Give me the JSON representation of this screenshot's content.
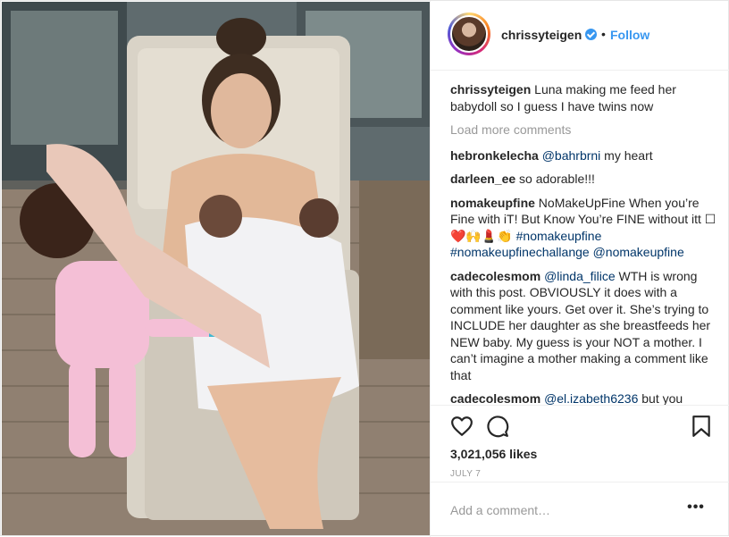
{
  "colors": {
    "link": "#3897f0",
    "hashtag": "#003569",
    "muted": "#999999",
    "text": "#262626",
    "border": "#efefef"
  },
  "photo": {
    "icon": "post-photo"
  },
  "header": {
    "username": "chrissyteigen",
    "verified_icon": "verified-badge-icon",
    "separator": "•",
    "follow_label": "Follow"
  },
  "caption": {
    "username": "chrissyteigen",
    "text": " Luna making me feed her babydoll so I guess I have twins now"
  },
  "load_more_label": "Load more comments",
  "comments": [
    {
      "username": "hebronkelecha",
      "mention": "@bahrbrni",
      "text": " my heart"
    },
    {
      "username": "darleen_ee",
      "text": " so adorable!!!"
    },
    {
      "username": "nomakeupfine",
      "text": " NoMakeUpFine When you’re Fine with iT! But Know You’re FINE without itt ☐❤️🙌💄👏",
      "tags": "#nomakeupfine #nomakeupfinechallange @nomakeupfine"
    },
    {
      "username": "cadecolesmom",
      "mention": "@linda_filice",
      "text": " WTH is wrong with this post. OBVIOUSLY it does with a comment like yours. Get over it. She’s trying to INCLUDE her daughter as she breastfeeds her NEW baby. My guess is your NOT a mother. I can’t imagine a mother making a comment like that"
    },
    {
      "username": "cadecolesmom",
      "mention": "@el.izabeth6236",
      "text": " but you"
    }
  ],
  "actions": {
    "like_icon": "heart-icon",
    "comment_icon": "comment-icon",
    "save_icon": "bookmark-icon"
  },
  "likes_text": "3,021,056 likes",
  "date_text": "JULY 7",
  "add_comment": {
    "placeholder": "Add a comment…",
    "more_label": "•••"
  }
}
